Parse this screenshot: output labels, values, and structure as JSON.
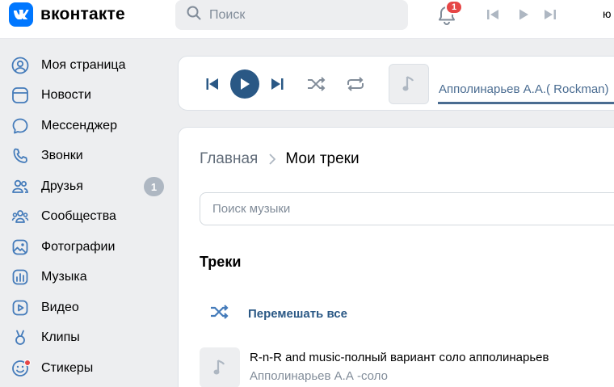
{
  "header": {
    "logo_text": "вконтакте",
    "search_placeholder": "Поиск",
    "notifications_count": "1",
    "user_initial": "ю"
  },
  "sidebar": {
    "items": [
      {
        "label": "Моя страница",
        "icon": "user-circle-icon"
      },
      {
        "label": "Новости",
        "icon": "newspaper-icon"
      },
      {
        "label": "Мессенджер",
        "icon": "message-bubble-icon"
      },
      {
        "label": "Звонки",
        "icon": "phone-icon"
      },
      {
        "label": "Друзья",
        "icon": "users-icon",
        "badge": "1"
      },
      {
        "label": "Сообщества",
        "icon": "community-icon"
      },
      {
        "label": "Фотографии",
        "icon": "photo-icon"
      },
      {
        "label": "Музыка",
        "icon": "music-bars-icon"
      },
      {
        "label": "Видео",
        "icon": "video-icon"
      },
      {
        "label": "Клипы",
        "icon": "clips-icon"
      },
      {
        "label": "Стикеры",
        "icon": "smile-icon"
      }
    ]
  },
  "player": {
    "now_playing": "Апполинарьев А.А.( Rockman)"
  },
  "main": {
    "breadcrumb_home": "Главная",
    "breadcrumb_current": "Мои треки",
    "search_placeholder": "Поиск музыки",
    "tracks_heading": "Треки",
    "shuffle_label": "Перемешать все",
    "tracks": [
      {
        "title": "R-n-R and music-полный вариант соло апполинарьев",
        "artist": "Апполинарьев А.А -соло"
      }
    ]
  },
  "colors": {
    "brand": "#0077ff",
    "link": "#2a5885",
    "icon": "#447bba",
    "badge_red": "#e64646"
  }
}
